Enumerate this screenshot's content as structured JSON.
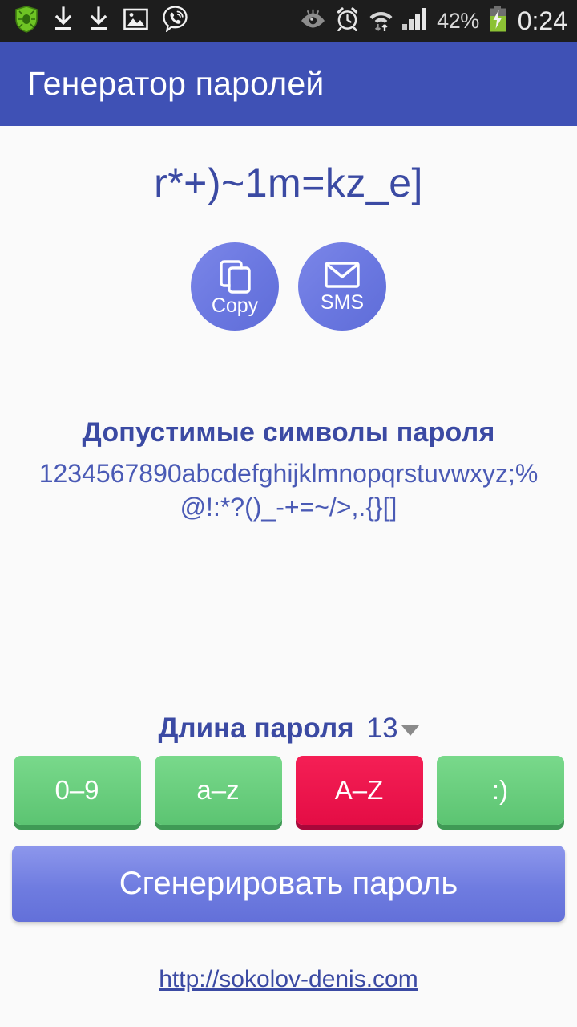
{
  "statusbar": {
    "left_icons": [
      "shield-antivirus-icon",
      "download-icon",
      "download-icon",
      "gallery-image-icon",
      "viber-icon"
    ],
    "right_icons": [
      "eye-smart-stay-icon",
      "alarm-clock-icon",
      "wifi-data-icon",
      "signal-bars-icon",
      "battery-charging-icon"
    ],
    "battery_percent": "42%",
    "clock": "0:24"
  },
  "appbar": {
    "title": "Генератор паролей"
  },
  "main": {
    "password": "r*+)~1m=kz_e]",
    "copy_label": "Copy",
    "sms_label": "SMS",
    "charset_title": "Допустимые символы пароля",
    "charset_value": "1234567890abcdefghijklmnopqrstuvwxyz;%@!:*?()_-+=~/>,.{}[]"
  },
  "controls": {
    "length_label": "Длина пароля",
    "length_value": "13",
    "toggles": [
      {
        "label": "0–9",
        "state": "on"
      },
      {
        "label": "a–z",
        "state": "on"
      },
      {
        "label": "A–Z",
        "state": "off"
      },
      {
        "label": ":)",
        "state": "on"
      }
    ],
    "generate_label": "Сгенерировать пароль"
  },
  "footer": {
    "link": "http://sokolov-denis.com"
  },
  "colors": {
    "appbar": "#3f51b5",
    "accent_text": "#3b4aa3",
    "button_blue": "#6f7ce0",
    "toggle_on": "#5cc472",
    "toggle_off": "#e40d45",
    "background": "#fafafa",
    "statusbar": "#1d1d1d"
  }
}
